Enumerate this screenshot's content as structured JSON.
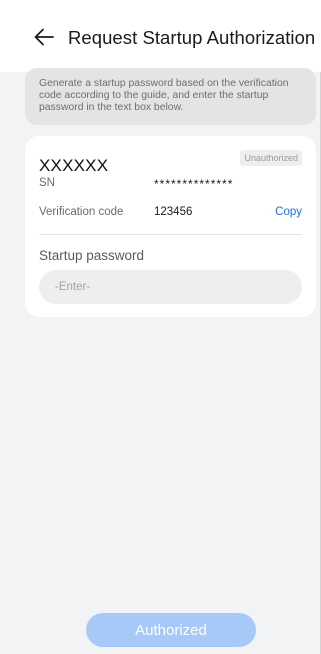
{
  "header": {
    "back_icon": "arrow-left-icon",
    "title": "Request Startup Authorization"
  },
  "hint": {
    "text": "Generate a startup password based on the verification code according to the guide, and enter the startup password in the text box below."
  },
  "device": {
    "name": "XXXXXX",
    "status": "Unauthorized",
    "sn_label": "SN",
    "sn_value": "**************",
    "verification_label": "Verification code",
    "verification_value": "123456",
    "copy_label": "Copy"
  },
  "password": {
    "label": "Startup password",
    "placeholder": "-Enter-",
    "value": ""
  },
  "footer": {
    "button_label": "Authorized"
  },
  "colors": {
    "accent": "#1a6fd8",
    "button_disabled": "#a7c9f7",
    "page_background": "#f1f3f5"
  }
}
